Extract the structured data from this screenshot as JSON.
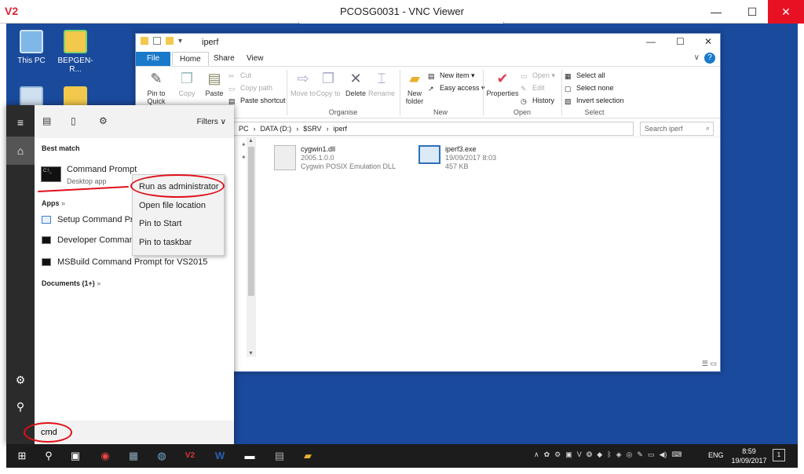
{
  "vnc": {
    "logo": "V2",
    "title": "PCOSG0031 - VNC Viewer",
    "min": "—",
    "max": "☐",
    "close": "✕"
  },
  "desktop": {
    "icons": [
      {
        "label": "This PC"
      },
      {
        "label": "BEPGEN-R..."
      }
    ],
    "bg_color": "#1a4a9c"
  },
  "explorer": {
    "window_name": "iperf",
    "tabs": {
      "file": "File",
      "home": "Home",
      "share": "Share",
      "view": "View"
    },
    "ribbon": {
      "clipboard": {
        "pin": "Pin to Quick access",
        "copy": "Copy",
        "paste": "Paste",
        "cut": "Cut",
        "copy_path": "Copy path",
        "paste_shortcut": "Paste shortcut"
      },
      "organise": {
        "move_to": "Move to",
        "copy_to": "Copy to",
        "delete": "Delete",
        "rename": "Rename",
        "group": "Organise"
      },
      "new": {
        "new_folder": "New folder",
        "new_item": "New item",
        "easy_access": "Easy access",
        "group": "New"
      },
      "open": {
        "properties": "Properties",
        "open": "Open",
        "edit": "Edit",
        "history": "History",
        "group": "Open"
      },
      "select": {
        "select_all": "Select all",
        "select_none": "Select none",
        "invert": "Invert selection",
        "group": "Select"
      }
    },
    "address": {
      "pc": "PC",
      "sep1": "›",
      "drive": "DATA (D:)",
      "sep2": "›",
      "srv": "$SRV",
      "sep3": "›",
      "folder": "iperf"
    },
    "search_placeholder": "Search iperf",
    "files": [
      {
        "name": "cygwin1.dll",
        "line2": "2005.1.0.0",
        "line3": "Cygwin POSIX Emulation DLL"
      },
      {
        "name": "iperf3.exe",
        "line2": "19/09/2017 8:03",
        "line3": "457 KB"
      }
    ]
  },
  "start_menu": {
    "filters": "Filters",
    "best_match_header": "Best match",
    "best_match": {
      "name": "Command Prompt",
      "sub": "Desktop app"
    },
    "apps_header": "Apps",
    "apps": [
      {
        "label": "Setup Command Pr"
      },
      {
        "label": "Developer Comman"
      },
      {
        "label": "MSBuild Command Prompt for VS2015"
      }
    ],
    "documents_header": "Documents (1+)",
    "chevron": "»",
    "search_value": "cmd"
  },
  "context_menu": {
    "items": [
      "Run as administrator",
      "Open file location",
      "Pin to Start",
      "Pin to taskbar"
    ]
  },
  "taskbar": {
    "language": "ENG",
    "time": "8:59",
    "date": "19/09/2017",
    "notif_count": "1"
  },
  "colors": {
    "accent": "#1979ca",
    "annotation": "#e0101a",
    "taskbar": "#1c1c1c"
  }
}
